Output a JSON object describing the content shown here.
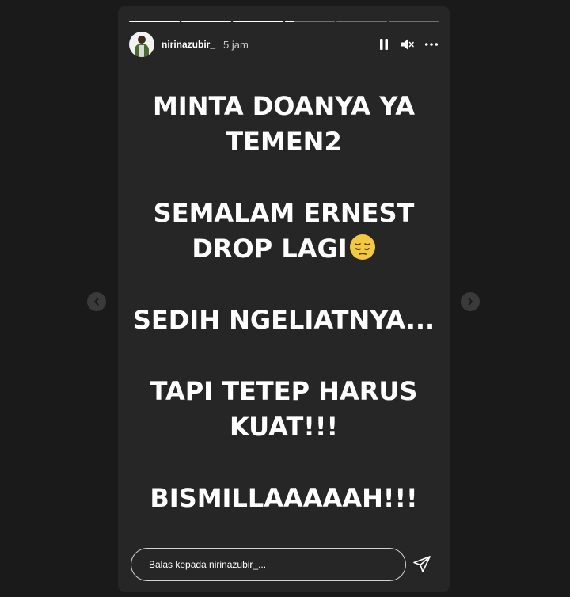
{
  "story": {
    "username": "nirinazubir_",
    "time_ago": "5 jam",
    "progress": [
      1,
      1,
      1,
      0.2,
      0,
      0
    ]
  },
  "controls": {
    "pause_icon": "pause-icon",
    "mute_icon": "muted-speaker-icon",
    "more_icon": "more-options-icon"
  },
  "content": {
    "para1_line1": "MINTA DOANYA YA",
    "para1_line2": "TEMEN2",
    "para2_line1": "SEMALAM ERNEST",
    "para2_line2": "DROP LAGI",
    "emoji": "pensive-face-emoji",
    "para3": "SEDIH NGELIATNYA...",
    "para4_line1": "TAPI TETEP HARUS",
    "para4_line2": "KUAT!!!",
    "para5": "BISMILLAAAAAH!!!"
  },
  "reply": {
    "placeholder": "Balas kepada nirinazubir_..."
  },
  "colors": {
    "background": "#1a1a1a",
    "card": "#262626",
    "text": "#ffffff",
    "emoji": "#f5c842"
  }
}
